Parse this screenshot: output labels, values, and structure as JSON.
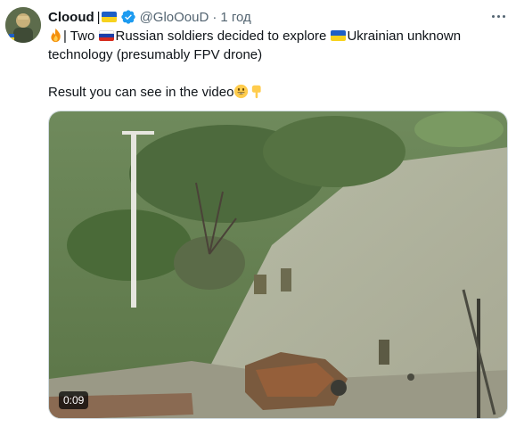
{
  "tweet": {
    "display_name": "Clooud",
    "separator": "|",
    "handle": "@GloOouD",
    "dot": "·",
    "time": "1 год",
    "text_line1_a": "| Two",
    "text_line1_b": "Russian soldiers decided to explore",
    "text_line1_c": "Ukrainian unknown",
    "text_line2": "technology (presumably FPV drone)",
    "text_line3": "Result you can see in the video",
    "video_duration": "0:09"
  },
  "colors": {
    "ua_blue": "#1d5fc6",
    "ua_yellow": "#f7d21e",
    "verified_blue": "#1d9bf0",
    "muted": "#536471"
  },
  "icons": {
    "verified": "verified-badge-icon",
    "more": "more-horizontal-icon",
    "fire": "fire-emoji",
    "smile": "smiling-emoji",
    "point_down": "pointing-down-emoji"
  }
}
